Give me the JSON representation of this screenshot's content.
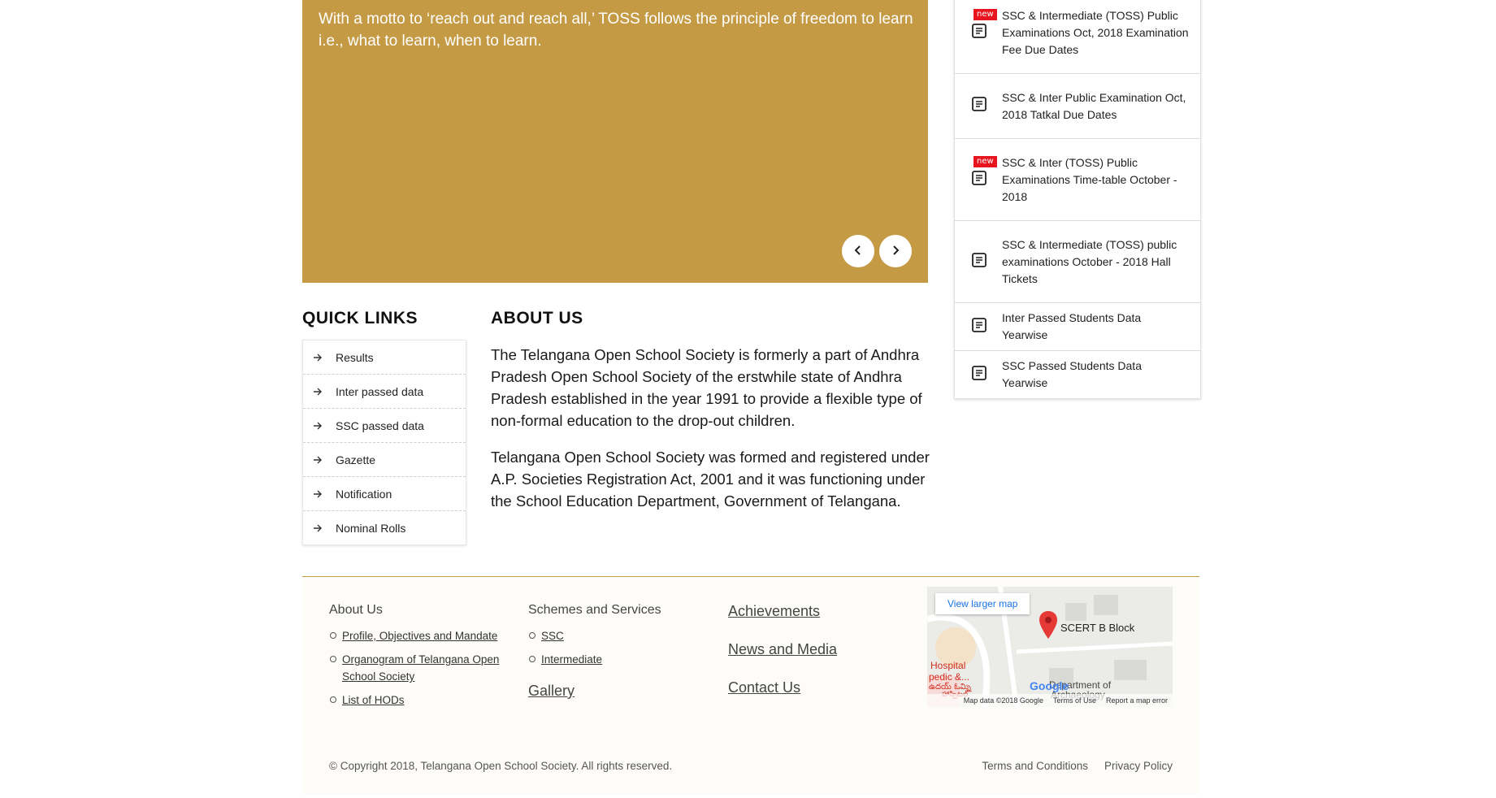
{
  "banner": {
    "text": "With a motto to ‘reach out and reach all,’ TOSS follows the principle of freedom to learn i.e., what to learn, when to learn."
  },
  "slider": {
    "prev_icon": "chevron-left-icon",
    "next_icon": "chevron-right-icon"
  },
  "notifications": {
    "new_label": "new",
    "items": [
      {
        "text": "SSC & Intermediate (TOSS) Public Examinations Oct, 2018 Examination Fee Due Dates",
        "is_new": true
      },
      {
        "text": "SSC & Inter Public Examination Oct, 2018 Tatkal Due Dates",
        "is_new": false
      },
      {
        "text": "SSC & Inter (TOSS) Public Examinations Time-table October - 2018",
        "is_new": true
      },
      {
        "text": "SSC & Intermediate (TOSS) public examinations October - 2018 Hall Tickets",
        "is_new": false
      },
      {
        "text": "Inter Passed Students Data Yearwise",
        "is_new": false
      },
      {
        "text": "SSC Passed Students Data Yearwise",
        "is_new": false
      }
    ]
  },
  "quick_links": {
    "title": "QUICK LINKS",
    "items": [
      "Results",
      "Inter passed data",
      "SSC passed data",
      "Gazette",
      "Notification",
      "Nominal Rolls"
    ]
  },
  "about": {
    "title": "ABOUT US",
    "paragraphs": [
      "The Telangana Open School Society is formerly a part of Andhra Pradesh Open School Society of the erstwhile state of Andhra Pradesh established in the year 1991 to provide a flexible type of non-formal education to the drop-out children.",
      "Telangana Open School Society was formed and registered under A.P. Societies Registration Act, 2001 and it was functioning under the School Education Department, Government of Telangana."
    ]
  },
  "footer": {
    "col1": {
      "heading": "About Us",
      "links": [
        "Profile, Objectives and Mandate",
        "Organogram of Telangana Open School Society",
        "List of HODs"
      ]
    },
    "col2": {
      "heading": "Schemes and Services",
      "links": [
        "SSC",
        "Intermediate"
      ],
      "gallery": "Gallery"
    },
    "col3": {
      "links": [
        "Achievements",
        "News and Media",
        "Contact Us"
      ]
    },
    "map": {
      "view_larger": "View larger map",
      "place": "SCERT B Block",
      "label_hospital": "Hospital",
      "label_pedic": "pedic &...",
      "label_telugu1": "ఉదయ్ ఓమ్ని",
      "label_telugu2": "హాస్పిటల్",
      "label_dept": "Department of",
      "label_arch": "Archaeology",
      "google": "Google",
      "map_data": "Map data ©2018 Google",
      "terms": "Terms of Use",
      "report": "Report a map error"
    },
    "copyright": "© Copyright 2018, Telangana Open School Society. All rights reserved.",
    "terms": "Terms and Conditions",
    "privacy": "Privacy Policy"
  }
}
